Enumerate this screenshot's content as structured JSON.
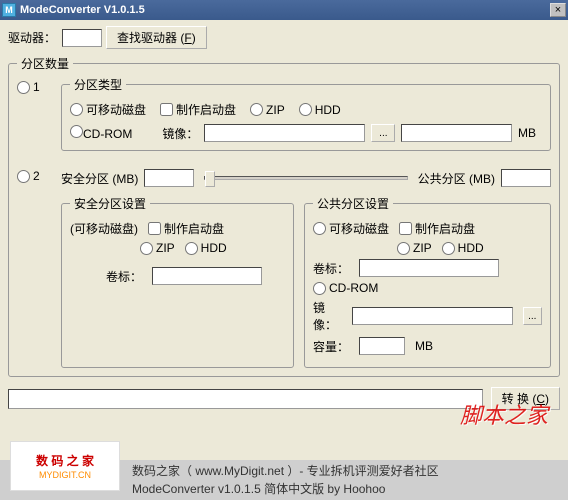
{
  "window": {
    "title": "ModeConverter V1.0.1.5",
    "close": "×",
    "icon": "M"
  },
  "row1": {
    "drive_label": "驱动器：",
    "find_btn": "查找驱动器 (",
    "find_key": "F",
    "find_end": ")"
  },
  "partitions": {
    "legend": "分区数量",
    "opt1": "1",
    "opt2": "2",
    "type_group": {
      "legend": "分区类型",
      "removable": "可移动磁盘",
      "bootdisk": "制作启动盘",
      "zip": "ZIP",
      "hdd": "HDD",
      "cdrom": "CD-ROM",
      "image": "镜像：",
      "mb": "MB"
    },
    "secure_label": "安全分区 (MB)",
    "public_label": "公共分区 (MB)",
    "secure_group": {
      "legend": "安全分区设置",
      "removable_hint": "(可移动磁盘)",
      "bootdisk": "制作启动盘",
      "zip": "ZIP",
      "hdd": "HDD",
      "vol": "卷标："
    },
    "public_group": {
      "legend": "公共分区设置",
      "removable": "可移动磁盘",
      "bootdisk": "制作启动盘",
      "zip": "ZIP",
      "hdd": "HDD",
      "vol": "卷标：",
      "cdrom": "CD-ROM",
      "image": "镜像：",
      "capacity": "容量：",
      "mb": "MB"
    }
  },
  "bottom": {
    "convert_btn": "转 换 (",
    "convert_key": "C",
    "convert_end": ")"
  },
  "footer": {
    "logo_main": "数 码 之 家",
    "logo_sub": "MYDIGIT.CN",
    "line1": "数码之家（ www.MyDigit.net ）- 专业拆机评测爱好者社区",
    "line2": "ModeConverter v1.0.1.5 简体中文版 by Hoohoo"
  },
  "watermark": "脚本之家"
}
